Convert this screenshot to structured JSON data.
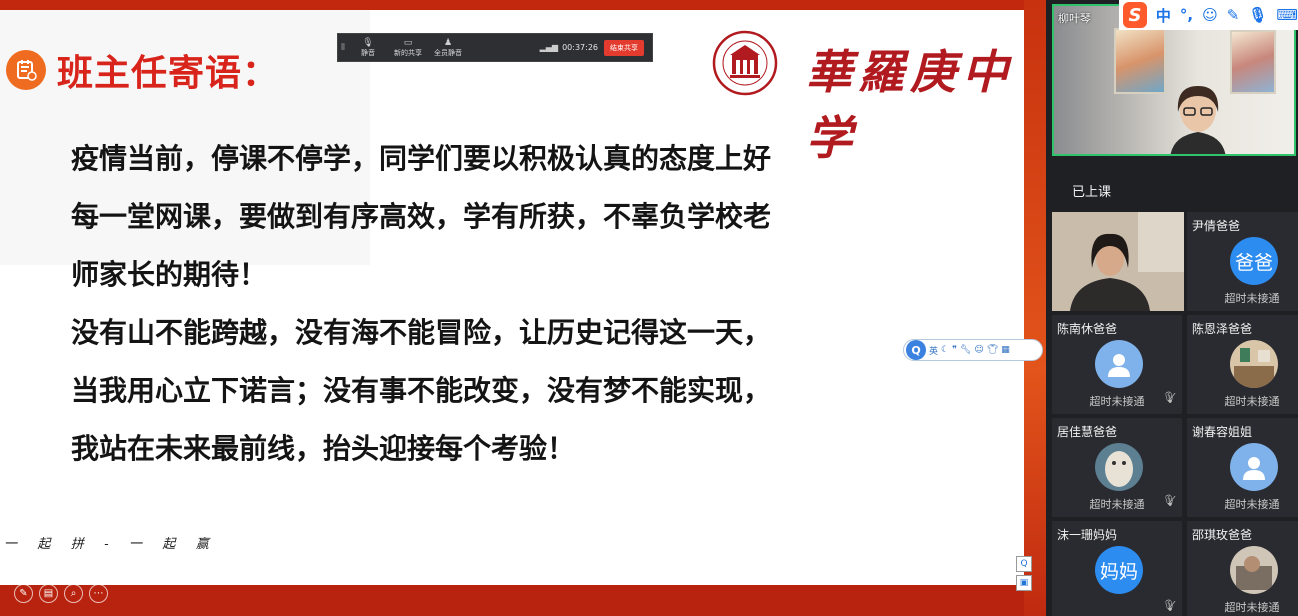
{
  "slide": {
    "title": "班主任寄语：",
    "body_lines": [
      "疫情当前，停课不停学，同学们要以积极认真的态度上好",
      "每一堂网课，要做到有序高效，学有所获，不辜负学校老",
      "师家长的期待！",
      "没有山不能跨越，没有海不能冒险，让历史记得这一天，",
      "当我用心立下诺言；没有事不能改变，没有梦不能实现，",
      "我站在未来最前线，抬头迎接每个考验！"
    ],
    "school_name": "華羅庚中学",
    "slogan": "一   起   拼   -   一   起   赢",
    "accent_color": "#d8241b",
    "frame_color": "#b8230f"
  },
  "meeting_bar": {
    "tools": [
      {
        "icon": "mic-icon",
        "label": "静音"
      },
      {
        "icon": "screen-share-icon",
        "label": "新的共享"
      },
      {
        "icon": "member-icon",
        "label": "全员静音"
      }
    ],
    "timer": "00:37:26",
    "end_share_label": "结束共享"
  },
  "ime_status": {
    "mode": "中",
    "punct": "°,",
    "icons": [
      "emoji-icon",
      "pen-icon",
      "mic-icon",
      "keyboard-icon"
    ]
  },
  "ime_toolbar": {
    "logo": "Q",
    "lang": "英",
    "icons": [
      "moon-icon",
      "quote-icon",
      "wrench-icon",
      "smile-icon",
      "shirt-icon",
      "grid-icon"
    ]
  },
  "teacher": {
    "name": "柳叶琴"
  },
  "section_label": "已上课",
  "participants": [
    {
      "name": "尹倩爸爸",
      "avatar_text": "爸爸",
      "status": "超时未接通",
      "avatar": "blue-text",
      "mic_off": false
    },
    {
      "name": "陈南休爸爸",
      "avatar_text": "",
      "status": "超时未接通",
      "avatar": "default",
      "mic_off": true
    },
    {
      "name": "陈恩泽爸爸",
      "avatar_text": "",
      "status": "超时未接通",
      "avatar": "photo-room",
      "mic_off": false
    },
    {
      "name": "居佳慧爸爸",
      "avatar_text": "",
      "status": "超时未接通",
      "avatar": "photo-cat",
      "mic_off": true
    },
    {
      "name": "谢春容姐姐",
      "avatar_text": "",
      "status": "超时未接通",
      "avatar": "default",
      "mic_off": false
    },
    {
      "name": "沫一珊妈妈",
      "avatar_text": "妈妈",
      "status": "",
      "avatar": "blue-text",
      "mic_off": true
    },
    {
      "name": "邵琪玫爸爸",
      "avatar_text": "",
      "status": "超时未接通",
      "avatar": "photo-person",
      "mic_off": false
    }
  ]
}
